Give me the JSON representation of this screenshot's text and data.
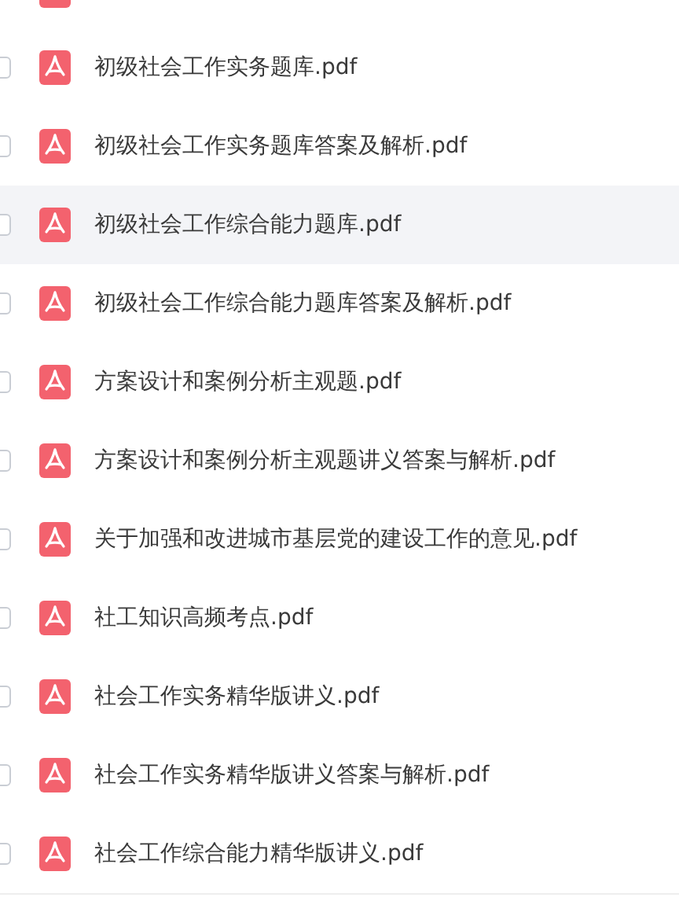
{
  "files": [
    {
      "name": "初级社会工作实务题库.pdf",
      "highlighted": false
    },
    {
      "name": "初级社会工作实务题库答案及解析.pdf",
      "highlighted": false
    },
    {
      "name": "初级社会工作综合能力题库.pdf",
      "highlighted": true
    },
    {
      "name": "初级社会工作综合能力题库答案及解析.pdf",
      "highlighted": false
    },
    {
      "name": "方案设计和案例分析主观题.pdf",
      "highlighted": false
    },
    {
      "name": "方案设计和案例分析主观题讲义答案与解析.pdf",
      "highlighted": false
    },
    {
      "name": "关于加强和改进城市基层党的建设工作的意见.pdf",
      "highlighted": false
    },
    {
      "name": "社工知识高频考点.pdf",
      "highlighted": false
    },
    {
      "name": "社会工作实务精华版讲义.pdf",
      "highlighted": false
    },
    {
      "name": "社会工作实务精华版讲义答案与解析.pdf",
      "highlighted": false
    },
    {
      "name": "社会工作综合能力精华版讲义.pdf",
      "highlighted": false
    }
  ]
}
